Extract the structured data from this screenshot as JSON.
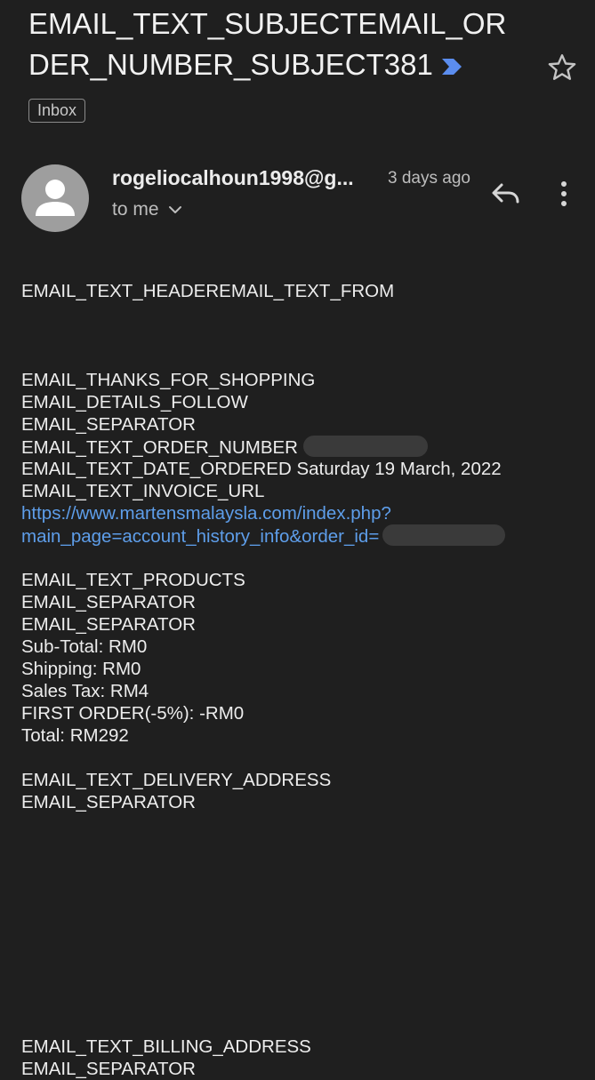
{
  "email": {
    "subject": "EMAIL_TEXT_SUBJECTEMAIL_ORDER_NUMBER_SUBJECT381",
    "label": "Inbox",
    "sender": "rogeliocalhoun1998@g...",
    "time_ago": "3 days ago",
    "recipient": "to me"
  },
  "body": {
    "header_line": "EMAIL_TEXT_HEADEREMAIL_TEXT_FROM",
    "thanks": "EMAIL_THANKS_FOR_SHOPPING",
    "details_follow": "EMAIL_DETAILS_FOLLOW",
    "separator_1": "EMAIL_SEPARATOR",
    "order_number_label": "EMAIL_TEXT_ORDER_NUMBER",
    "date_ordered": "EMAIL_TEXT_DATE_ORDERED Saturday 19 March, 2022",
    "invoice_url_label": "EMAIL_TEXT_INVOICE_URL",
    "invoice_link_line1": "https://www.martensmalaysla.com/index.php?",
    "invoice_link_line2": "main_page=account_history_info&order_id=",
    "products_label": "EMAIL_TEXT_PRODUCTS",
    "separator_2": "EMAIL_SEPARATOR",
    "separator_3": "EMAIL_SEPARATOR",
    "sub_total": "Sub-Total: RM0",
    "shipping": "Shipping: RM0",
    "sales_tax": "Sales Tax: RM4",
    "first_order": "FIRST ORDER(-5%): -RM0",
    "total": "Total: RM292",
    "delivery_address_label": "EMAIL_TEXT_DELIVERY_ADDRESS",
    "separator_4": "EMAIL_SEPARATOR",
    "billing_address_label": "EMAIL_TEXT_BILLING_ADDRESS",
    "separator_5": "EMAIL_SEPARATOR"
  },
  "icons": {
    "importance_marker": "label-importance-icon",
    "star": "star-outline-icon",
    "reply": "reply-icon",
    "more": "more-vertical-icon",
    "expand_recipients": "chevron-down-icon",
    "avatar": "person-avatar-icon"
  },
  "colors": {
    "background": "#1f1f1f",
    "link": "#5e9eea",
    "importance": "#5b8def",
    "avatar_bg": "#9e9e9e",
    "redaction": "#3a3a3a"
  }
}
